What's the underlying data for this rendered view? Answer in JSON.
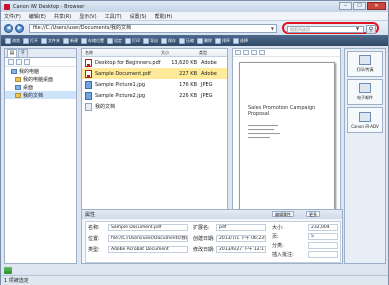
{
  "window": {
    "title": "Canon iW Desktop - Browser"
  },
  "menu": [
    "文件(F)",
    "编辑(E)",
    "共享(R)",
    "显示(V)",
    "工具(T)",
    "设置(S)",
    "帮助(H)"
  ],
  "address": {
    "path": "file://C:/Users/user/Documents/我的文档"
  },
  "search": {
    "placeholder": "搜索所选项"
  },
  "toolbar": [
    "浏览",
    "打开",
    "文件夹",
    "新建",
    "存储位置",
    "设定",
    "打印",
    "导出",
    "保存",
    "压缩",
    "删除",
    "排序",
    "选择"
  ],
  "left_tree": [
    {
      "label": "我的电脑"
    },
    {
      "label": "我的电脑桌面"
    },
    {
      "label": "桌面"
    },
    {
      "label": "我的文档"
    }
  ],
  "file_list": {
    "headers": {
      "name": "名称",
      "size": "大小",
      "type": "类型"
    },
    "rows": [
      {
        "name": "Desktop for Beginners.pdf",
        "size": "13,620 KB",
        "type": "Adobe"
      },
      {
        "name": "Sample Document.pdf",
        "size": "227 KB",
        "type": "Adobe"
      },
      {
        "name": "Sample Picture1.jpg",
        "size": "176 KB",
        "type": "JPEG"
      },
      {
        "name": "Sample Picture2.jpg",
        "size": "226 KB",
        "type": "JPEG"
      },
      {
        "name": "我的文档",
        "size": "",
        "type": ""
      }
    ]
  },
  "preview": {
    "title": "Sales Promotion Campaign Proposal",
    "page": "1/1"
  },
  "right_panel": [
    {
      "label": "打印/传真"
    },
    {
      "label": "电子邮件"
    },
    {
      "label": "Canon iR-ADV"
    }
  ],
  "properties": {
    "header": "属性",
    "edit_button": "编辑属性",
    "more_button": "更多",
    "fields": [
      {
        "label": "名称:",
        "value": "Sample Document.pdf"
      },
      {
        "label": "位置:",
        "value": "file://C:/Users/user/Documents/我的文档"
      },
      {
        "label": "类型:",
        "value": "Adobe Acrobat Document"
      },
      {
        "label": "扩展名:",
        "value": "pdf"
      },
      {
        "label": "创建日期:",
        "value": "2013/7/1 下午 06:23:39"
      },
      {
        "label": "修改日期:",
        "value": "2013/6/27 下午 12:11:03"
      },
      {
        "label": "大小:",
        "value": "232,004"
      },
      {
        "label": "页:",
        "value": "5"
      },
      {
        "label": "分类:",
        "value": ""
      },
      {
        "label": "插入批注:",
        "value": ""
      }
    ]
  },
  "status": {
    "text": "1 项被选定"
  }
}
